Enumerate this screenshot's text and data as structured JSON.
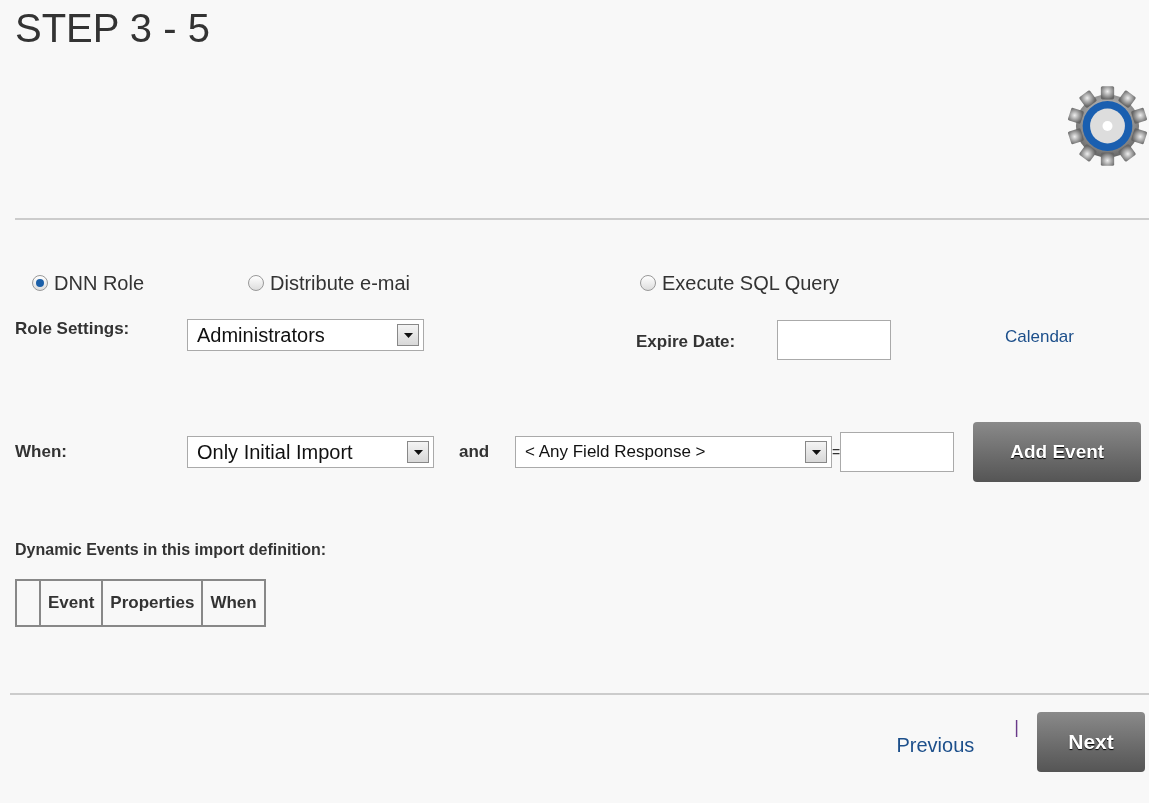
{
  "title": "STEP 3 - 5",
  "action_types": [
    {
      "label": "DNN Role",
      "selected": true
    },
    {
      "label": "Distribute e-mai",
      "selected": false
    },
    {
      "label": "Execute SQL Query",
      "selected": false
    }
  ],
  "role_settings": {
    "label": "Role Settings:",
    "value": "Administrators"
  },
  "expire_date": {
    "label": "Expire Date:",
    "link": "Calendar"
  },
  "when": {
    "label": "When:",
    "value": "Only Initial Import",
    "joiner": "and",
    "field": "< Any Field Response >",
    "equals": "=",
    "button": "Add Event"
  },
  "events": {
    "heading": "Dynamic Events in this import definition:",
    "columns": [
      "",
      "Event",
      "Properties",
      "When"
    ]
  },
  "footer": {
    "previous": "Previous",
    "separator": "|",
    "next": "Next"
  }
}
